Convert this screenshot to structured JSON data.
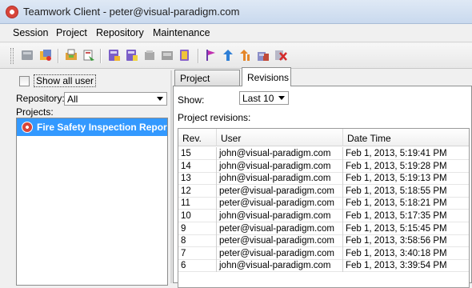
{
  "window": {
    "title": "Teamwork Client - peter@visual-paradigm.com"
  },
  "menubar": {
    "items": [
      "Session",
      "Project",
      "Repository",
      "Maintenance"
    ]
  },
  "left_panel": {
    "show_all_user_label": "Show all user",
    "repository_label": "Repository:",
    "repository_value": "All",
    "projects_label": "Projects:",
    "project_items": [
      "Fire Safety Inspection Repor"
    ]
  },
  "tabs": [
    "Project Details",
    "Revisions"
  ],
  "revisions": {
    "show_label": "Show:",
    "show_value": "Last 10",
    "project_revisions_label": "Project revisions:",
    "columns": [
      "Rev.",
      "User",
      "Date Time"
    ],
    "rows": [
      [
        "15",
        "john@visual-paradigm.com",
        "Feb 1, 2013, 5:19:41 PM"
      ],
      [
        "14",
        "john@visual-paradigm.com",
        "Feb 1, 2013, 5:19:28 PM"
      ],
      [
        "13",
        "john@visual-paradigm.com",
        "Feb 1, 2013, 5:19:13 PM"
      ],
      [
        "12",
        "peter@visual-paradigm.com",
        "Feb 1, 2013, 5:18:55 PM"
      ],
      [
        "11",
        "peter@visual-paradigm.com",
        "Feb 1, 2013, 5:18:21 PM"
      ],
      [
        "10",
        "john@visual-paradigm.com",
        "Feb 1, 2013, 5:17:35 PM"
      ],
      [
        "9",
        "peter@visual-paradigm.com",
        "Feb 1, 2013, 5:15:45 PM"
      ],
      [
        "8",
        "peter@visual-paradigm.com",
        "Feb 1, 2013, 3:58:56 PM"
      ],
      [
        "7",
        "peter@visual-paradigm.com",
        "Feb 1, 2013, 3:40:18 PM"
      ],
      [
        "6",
        "john@visual-paradigm.com",
        "Feb 1, 2013, 3:39:54 PM"
      ]
    ]
  },
  "toolbar": {
    "icons": [
      "commit-icon",
      "update-icon",
      "import-icon",
      "export-icon",
      "open-project-icon",
      "new-project-icon",
      "delete-project-icon",
      "save-icon",
      "branch-icon",
      "flag-icon",
      "up-arrow-icon",
      "merge-icon",
      "lock-icon",
      "delete-icon"
    ]
  }
}
